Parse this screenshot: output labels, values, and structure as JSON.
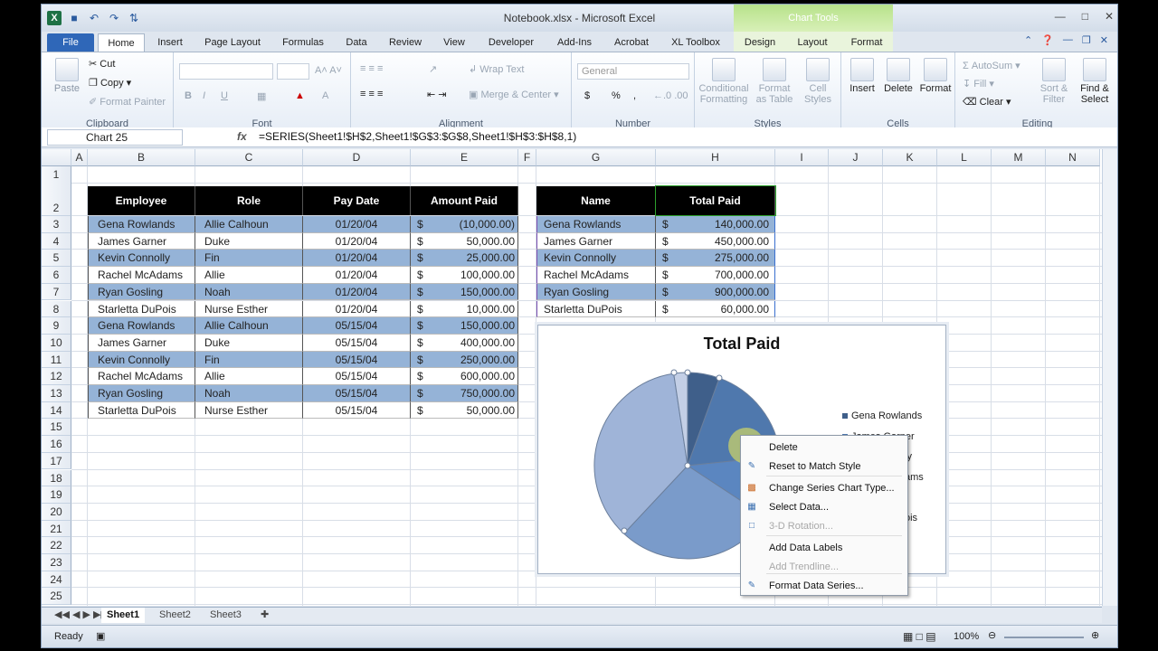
{
  "window": {
    "title": "Notebook.xlsx - Microsoft Excel",
    "chart_tools_label": "Chart Tools"
  },
  "tabs": [
    "File",
    "Home",
    "Insert",
    "Page Layout",
    "Formulas",
    "Data",
    "Review",
    "View",
    "Developer",
    "Add-Ins",
    "Acrobat",
    "XL Toolbox",
    "Design",
    "Layout",
    "Format"
  ],
  "ribbon": {
    "clipboard": {
      "label": "Clipboard",
      "paste": "Paste",
      "cut": "Cut",
      "copy": "Copy",
      "format_painter": "Format Painter"
    },
    "font": {
      "label": "Font"
    },
    "alignment": {
      "label": "Alignment",
      "wrap_text": "Wrap Text",
      "merge_center": "Merge & Center"
    },
    "number": {
      "label": "Number",
      "format": "General",
      "currency": "$",
      "percent": "%",
      "comma": ","
    },
    "styles": {
      "label": "Styles",
      "conditional": "Conditional Formatting",
      "format_table": "Format as Table",
      "cell_styles": "Cell Styles"
    },
    "cells": {
      "label": "Cells",
      "insert": "Insert",
      "delete": "Delete",
      "format": "Format"
    },
    "editing": {
      "label": "Editing",
      "autosum": "AutoSum",
      "fill": "Fill",
      "clear": "Clear",
      "sort_filter": "Sort & Filter",
      "find_select": "Find & Select"
    }
  },
  "formula_bar": {
    "name_box": "Chart 25",
    "fx": "fx",
    "formula": "=SERIES(Sheet1!$H$2,Sheet1!$G$3:$G$8,Sheet1!$H$3:$H$8,1)"
  },
  "columns": [
    "A",
    "B",
    "C",
    "D",
    "E",
    "F",
    "G",
    "H",
    "I",
    "J",
    "K",
    "L",
    "M",
    "N"
  ],
  "rows": [
    "1",
    "2",
    "3",
    "4",
    "5",
    "6",
    "7",
    "8",
    "9",
    "10",
    "11",
    "12",
    "13",
    "14",
    "15",
    "16",
    "17",
    "18",
    "19",
    "20",
    "21",
    "22",
    "23",
    "24",
    "25"
  ],
  "table1": {
    "headers": [
      "Employee",
      "Role",
      "Pay Date",
      "Amount Paid"
    ],
    "rows": [
      [
        "Gena Rowlands",
        "Allie Calhoun",
        "01/20/04",
        "(10,000.00)"
      ],
      [
        "James Garner",
        "Duke",
        "01/20/04",
        "50,000.00"
      ],
      [
        "Kevin Connolly",
        "Fin",
        "01/20/04",
        "25,000.00"
      ],
      [
        "Rachel McAdams",
        "Allie",
        "01/20/04",
        "100,000.00"
      ],
      [
        "Ryan Gosling",
        "Noah",
        "01/20/04",
        "150,000.00"
      ],
      [
        "Starletta DuPois",
        "Nurse Esther",
        "01/20/04",
        "10,000.00"
      ],
      [
        "Gena Rowlands",
        "Allie Calhoun",
        "05/15/04",
        "150,000.00"
      ],
      [
        "James Garner",
        "Duke",
        "05/15/04",
        "400,000.00"
      ],
      [
        "Kevin Connolly",
        "Fin",
        "05/15/04",
        "250,000.00"
      ],
      [
        "Rachel McAdams",
        "Allie",
        "05/15/04",
        "600,000.00"
      ],
      [
        "Ryan Gosling",
        "Noah",
        "05/15/04",
        "750,000.00"
      ],
      [
        "Starletta DuPois",
        "Nurse Esther",
        "05/15/04",
        "50,000.00"
      ]
    ],
    "currency": "$"
  },
  "table2": {
    "headers": [
      "Name",
      "Total Paid"
    ],
    "rows": [
      [
        "Gena Rowlands",
        "140,000.00"
      ],
      [
        "James Garner",
        "450,000.00"
      ],
      [
        "Kevin Connolly",
        "275,000.00"
      ],
      [
        "Rachel McAdams",
        "700,000.00"
      ],
      [
        "Ryan Gosling",
        "900,000.00"
      ],
      [
        "Starletta DuPois",
        "60,000.00"
      ]
    ],
    "currency": "$"
  },
  "chart_data": {
    "type": "pie",
    "title": "Total Paid",
    "categories": [
      "Gena Rowlands",
      "James Garner",
      "Kevin Connolly",
      "Rachel McAdams",
      "Ryan Gosling",
      "Starletta DuPois"
    ],
    "values": [
      140000,
      450000,
      275000,
      700000,
      900000,
      60000
    ],
    "colors": [
      "#3f5f8a",
      "#4f78ad",
      "#5b86c0",
      "#7a9bca",
      "#9fb4d8",
      "#c3cfe6"
    ],
    "legend_visible": [
      "Gena Rowlands",
      "James Garner",
      "ly",
      "ams",
      "",
      "ois"
    ]
  },
  "context_menu": {
    "items": [
      {
        "label": "Delete",
        "enabled": true
      },
      {
        "label": "Reset to Match Style",
        "enabled": true
      },
      {
        "label": "Change Series Chart Type...",
        "enabled": true
      },
      {
        "label": "Select Data...",
        "enabled": true
      },
      {
        "label": "3-D Rotation...",
        "enabled": false
      },
      {
        "label": "Add Data Labels",
        "enabled": true
      },
      {
        "label": "Add Trendline...",
        "enabled": false
      },
      {
        "label": "Format Data Series...",
        "enabled": true
      }
    ]
  },
  "sheets": [
    "Sheet1",
    "Sheet2",
    "Sheet3"
  ],
  "status": {
    "ready": "Ready",
    "zoom": "100%"
  }
}
